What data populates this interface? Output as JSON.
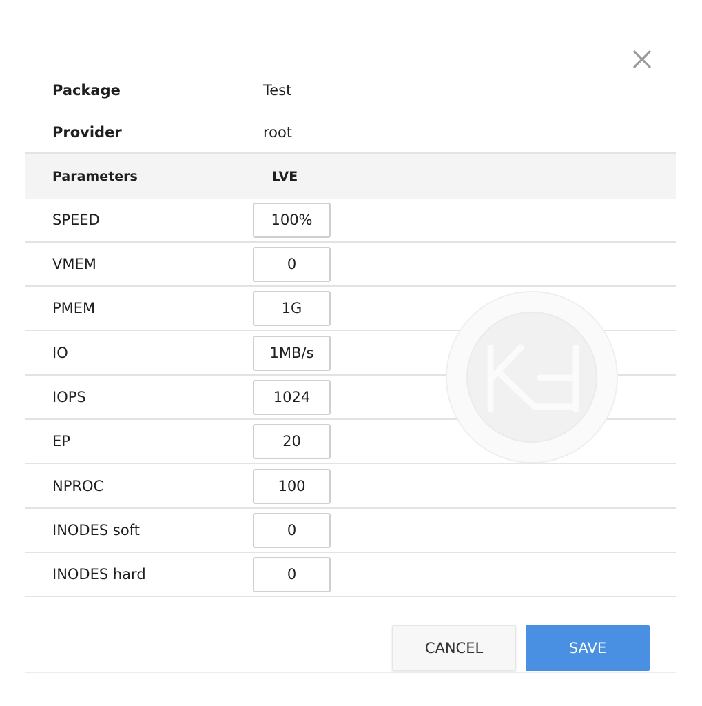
{
  "dialog": {
    "close_icon": "close-icon"
  },
  "info": {
    "package_label": "Package",
    "package_value": "Test",
    "provider_label": "Provider",
    "provider_value": "root"
  },
  "table": {
    "header_parameters": "Parameters",
    "header_lve": "LVE",
    "rows": [
      {
        "name": "SPEED",
        "value": "100%"
      },
      {
        "name": "VMEM",
        "value": "0"
      },
      {
        "name": "PMEM",
        "value": "1G"
      },
      {
        "name": "IO",
        "value": "1MB/s"
      },
      {
        "name": "IOPS",
        "value": "1024"
      },
      {
        "name": "EP",
        "value": "20"
      },
      {
        "name": "NPROC",
        "value": "100"
      },
      {
        "name": "INODES soft",
        "value": "0"
      },
      {
        "name": "INODES hard",
        "value": "0"
      }
    ]
  },
  "buttons": {
    "cancel_label": "CANCEL",
    "save_label": "SAVE"
  },
  "colors": {
    "save_button": "#4a90e2",
    "header_background": "#f4f4f4"
  }
}
